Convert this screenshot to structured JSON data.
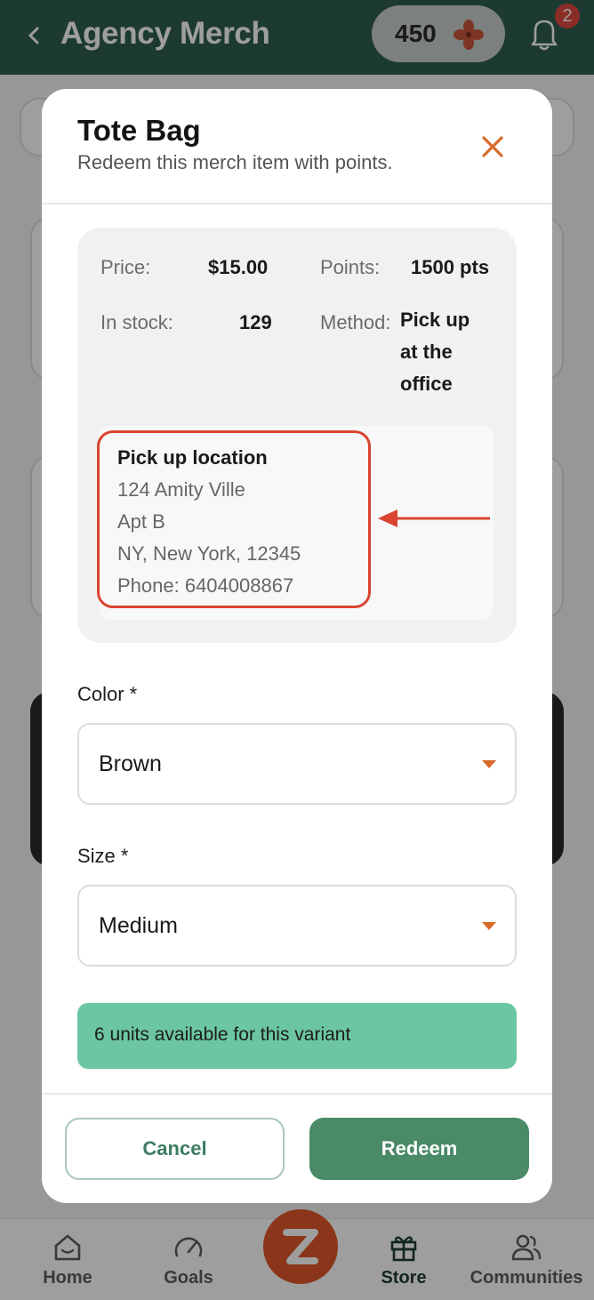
{
  "header": {
    "title": "Agency Merch",
    "points": "450",
    "notification_count": "2",
    "back_icon": "chevron-left-icon",
    "points_icon": "pinwheel-icon",
    "bell_icon": "bell-icon"
  },
  "bottom_nav": {
    "items": [
      {
        "label": "Home",
        "icon": "home-icon"
      },
      {
        "label": "Goals",
        "icon": "gauge-icon"
      },
      {
        "label": "Store",
        "icon": "gift-icon",
        "active": true
      },
      {
        "label": "Communities",
        "icon": "people-icon"
      }
    ]
  },
  "modal": {
    "title": "Tote Bag",
    "subtitle": "Redeem this merch item with points.",
    "close_icon": "close-icon",
    "details": {
      "price_label": "Price:",
      "price_value": "$15.00",
      "points_label": "Points:",
      "points_value": "1500 pts",
      "stock_label": "In stock:",
      "stock_value": "129",
      "method_label": "Method:",
      "method_lines": [
        "Pick up",
        "at the",
        "office"
      ]
    },
    "pickup": {
      "title": "Pick up location",
      "lines": [
        "124 Amity Ville",
        "Apt B",
        "NY, New York, 12345",
        "Phone: 6404008867"
      ]
    },
    "color": {
      "label": "Color *",
      "value": "Brown"
    },
    "size": {
      "label": "Size *",
      "value": "Medium"
    },
    "availability": "6 units available for this variant",
    "cancel_label": "Cancel",
    "redeem_label": "Redeem"
  },
  "colors": {
    "header": "#2f5e52",
    "accent_orange": "#d86a2a",
    "highlight_red": "#d94430",
    "available_green": "#6cc6a1",
    "redeem_green": "#4a8a66"
  }
}
